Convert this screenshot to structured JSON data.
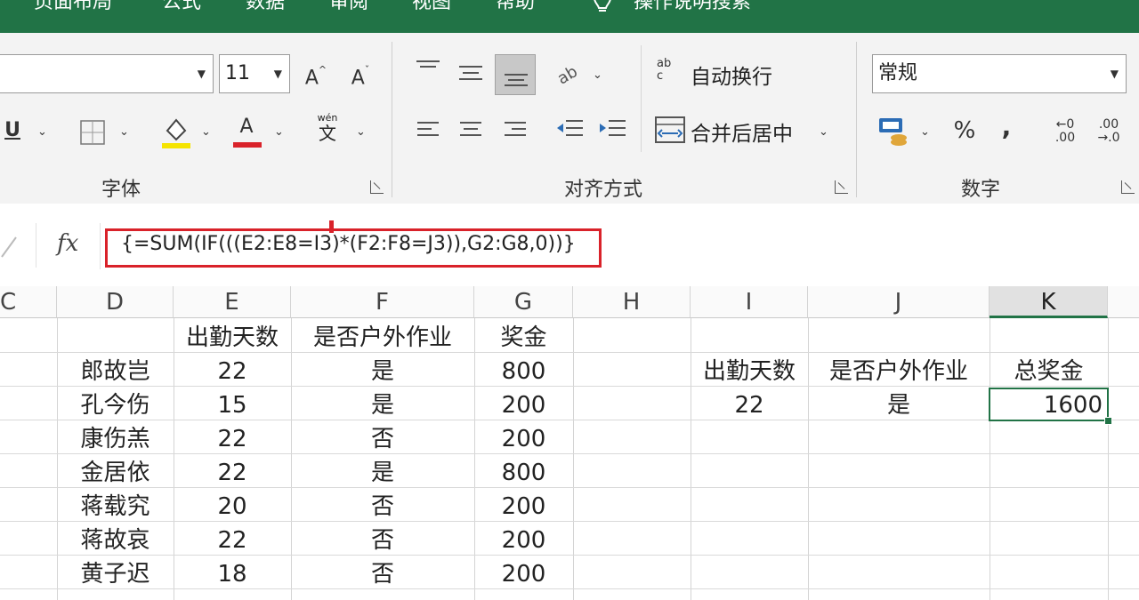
{
  "tabs": [
    "页面布局",
    "公式",
    "数据",
    "审阅",
    "视图",
    "帮助"
  ],
  "tell_me": "操作说明搜索",
  "ribbon": {
    "font": {
      "font_name": "",
      "font_size": "11",
      "grow_label": "A",
      "shrink_label": "A",
      "underline_label": "U",
      "font_color_label": "A",
      "phonetic_top": "wén",
      "phonetic_bottom": "文",
      "group_label": "字体"
    },
    "alignment": {
      "wrap_text": "自动换行",
      "wrap_icon_top": "ab",
      "wrap_icon_bottom": "c",
      "merge_center": "合并后居中",
      "group_label": "对齐方式"
    },
    "number": {
      "format": "常规",
      "percent": "%",
      "comma": ",",
      "inc_decimal_top": "←0",
      "inc_decimal_bottom": ".00",
      "dec_decimal_top": ".00",
      "dec_decimal_bottom": "→.0",
      "group_label": "数字"
    }
  },
  "formula_bar": {
    "fx": "fx",
    "formula": "{=SUM(IF(((E2:E8=I3)*(F2:F8=J3)),G2:G8,0))}"
  },
  "columns": [
    "C",
    "D",
    "E",
    "F",
    "G",
    "H",
    "I",
    "J",
    "K"
  ],
  "table": {
    "headers": [
      "出勤天数",
      "是否户外作业",
      "奖金"
    ],
    "rows": [
      {
        "name": "郎故岂",
        "days": "22",
        "outdoor": "是",
        "bonus": "800"
      },
      {
        "name": "孔今伤",
        "days": "15",
        "outdoor": "是",
        "bonus": "200"
      },
      {
        "name": "康伤羔",
        "days": "22",
        "outdoor": "否",
        "bonus": "200"
      },
      {
        "name": "金居依",
        "days": "22",
        "outdoor": "是",
        "bonus": "800"
      },
      {
        "name": "蒋载究",
        "days": "20",
        "outdoor": "否",
        "bonus": "200"
      },
      {
        "name": "蒋故哀",
        "days": "22",
        "outdoor": "否",
        "bonus": "200"
      },
      {
        "name": "黄子迟",
        "days": "18",
        "outdoor": "否",
        "bonus": "200"
      }
    ]
  },
  "criteria": {
    "headers": [
      "出勤天数",
      "是否户外作业",
      "总奖金"
    ],
    "days": "22",
    "outdoor": "是",
    "total": "1600"
  },
  "colors": {
    "excel_green": "#217346",
    "highlight_red": "#d9222a",
    "fill_yellow": "#f5e400"
  }
}
